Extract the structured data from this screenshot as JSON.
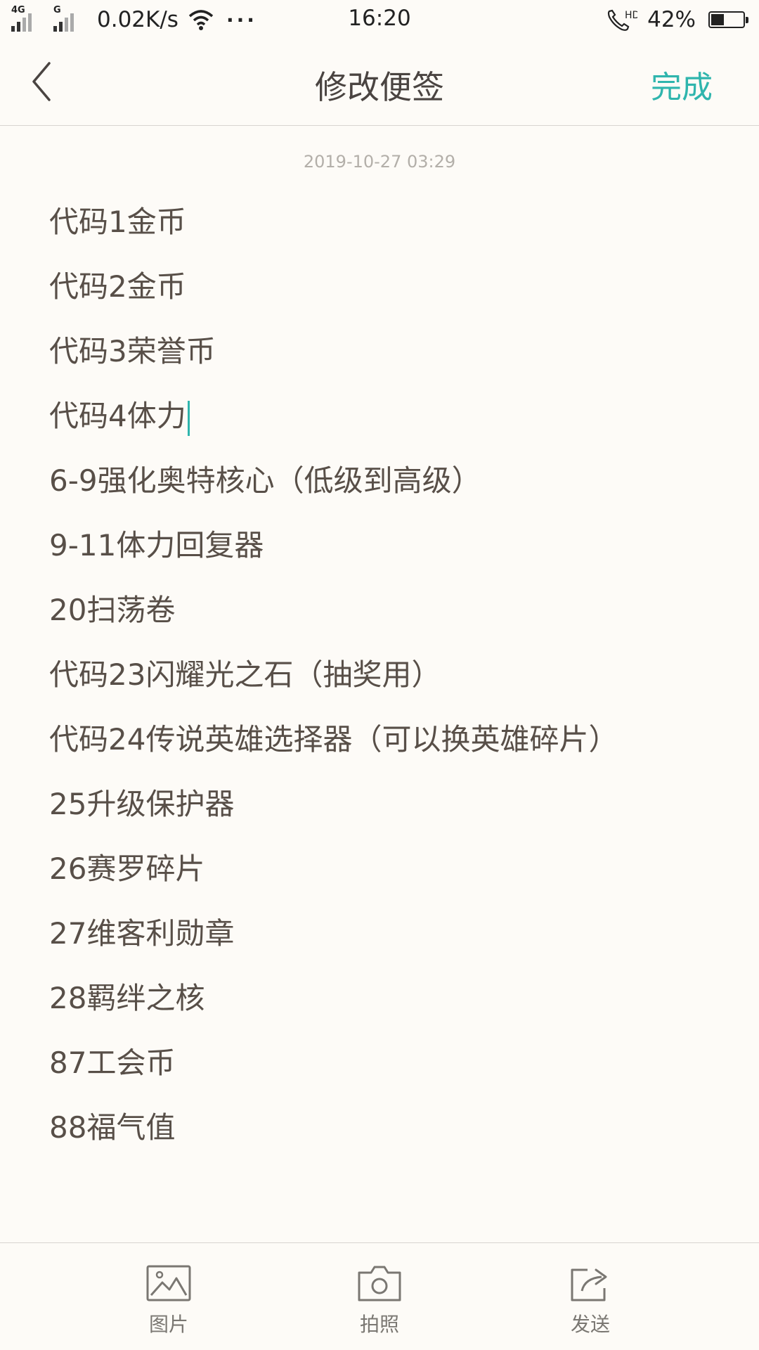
{
  "status_bar": {
    "network_1": "4G",
    "network_2": "G",
    "speed": "0.02K/s",
    "more": "···",
    "time": "16:20",
    "call_badge": "HD",
    "battery_text": "42%",
    "battery_level": 0.42
  },
  "header": {
    "title": "修改便签",
    "done_label": "完成"
  },
  "note": {
    "timestamp": "2019-10-27 03:29",
    "lines": [
      "代码1金币",
      "代码2金币",
      "代码3荣誉币",
      "代码4体力",
      "6-9强化奥特核心（低级到高级）",
      "9-11体力回复器",
      "20扫荡卷",
      "代码23闪耀光之石（抽奖用）",
      "代码24传说英雄选择器（可以换英雄碎片）",
      "25升级保护器",
      "26赛罗碎片",
      "27维客利勋章",
      "28羁绊之核",
      "87工会币",
      "88福气值"
    ]
  },
  "toolbar": {
    "picture_label": "图片",
    "camera_label": "拍照",
    "send_label": "发送"
  },
  "colors": {
    "accent": "#2fb5ad",
    "background": "#fdfbf7",
    "text": "#584f48"
  }
}
